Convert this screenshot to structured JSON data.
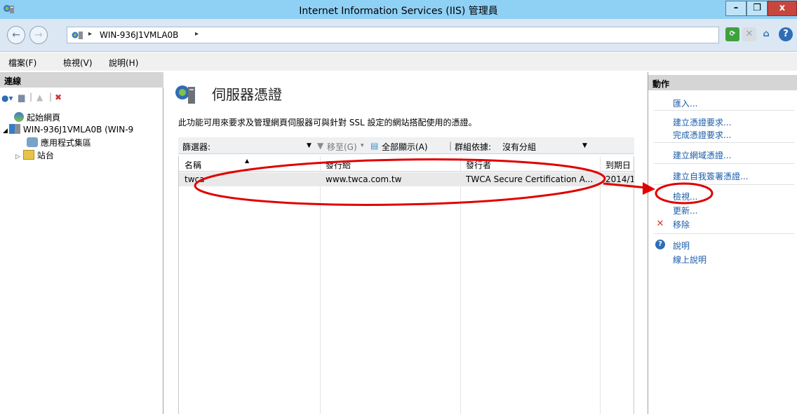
{
  "window": {
    "title": "Internet Information Services (IIS) 管理員",
    "min_label": "–",
    "max_label": "❐",
    "close_label": "x"
  },
  "address": {
    "path": "WIN-936J1VMLA0B",
    "sep1": "▸",
    "sep2": "▸"
  },
  "menu": {
    "file": "檔案(F)",
    "view": "檢視(V)",
    "help": "說明(H)"
  },
  "connections": {
    "header": "連線",
    "tree": [
      {
        "label": "起始網頁"
      },
      {
        "label": "WIN-936J1VMLA0B (WIN-9"
      },
      {
        "label": "應用程式集區"
      },
      {
        "label": "站台"
      }
    ]
  },
  "feature": {
    "title": "伺服器憑證",
    "description": "此功能可用來要求及管理網頁伺服器可與針對 SSL 設定的網站搭配使用的憑證。",
    "filter_label": "篩選器:",
    "goto_label": "移至(G)",
    "show_all_label": "全部顯示(A)",
    "group_by_label": "群組依據:",
    "group_by_value": "沒有分組"
  },
  "table": {
    "columns": [
      "名稱",
      "發行給",
      "發行者",
      "到期日"
    ],
    "rows": [
      [
        "twca",
        "www.twca.com.tw",
        "TWCA Secure Certification A...",
        "2014/1"
      ]
    ]
  },
  "actions": {
    "header": "動作",
    "import": "匯入...",
    "create_request": "建立憑證要求...",
    "complete_request": "完成憑證要求...",
    "create_domain": "建立網域憑證...",
    "create_self_signed": "建立自我簽署憑證...",
    "view": "檢視...",
    "renew": "更新...",
    "remove": "移除",
    "help": "說明",
    "online_help": "線上說明"
  },
  "colors": {
    "titlebar": "#8fd0f5",
    "link": "#1b5ca8",
    "annotation": "#e00000"
  }
}
